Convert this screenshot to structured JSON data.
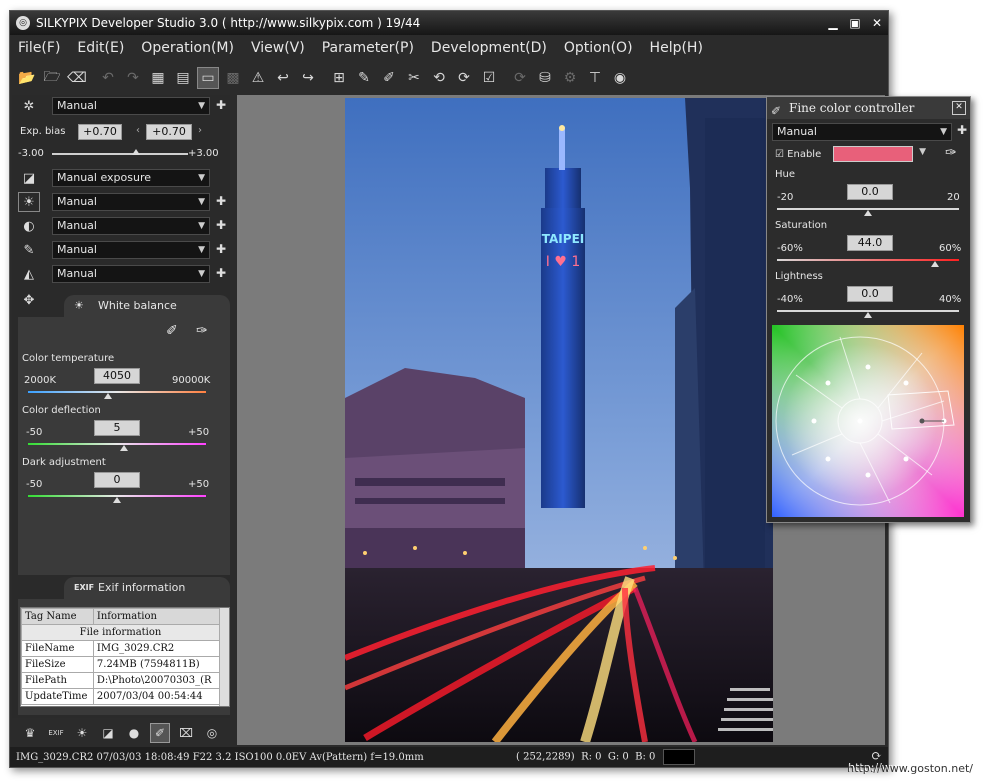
{
  "window": {
    "title": "SILKYPIX Developer Studio 3.0 ( http://www.silkypix.com )   19/44"
  },
  "menu": [
    "File(F)",
    "Edit(E)",
    "Operation(M)",
    "View(V)",
    "Parameter(P)",
    "Development(D)",
    "Option(O)",
    "Help(H)"
  ],
  "toolbar_icons": [
    "open-folder",
    "open-folder-2",
    "eraser",
    "undo",
    "redo",
    "grid-view",
    "filmstrip-view",
    "single-view",
    "compare-view",
    "warning",
    "back",
    "forward",
    "crop-grid",
    "pipette-1",
    "pipette-2",
    "spot",
    "rotate-left",
    "rotate-right",
    "checkmark",
    "refresh",
    "develop",
    "batch",
    "tone",
    "fine-color"
  ],
  "left": {
    "rows": [
      {
        "icon": "gear-icon",
        "value": "Manual"
      },
      {
        "icon": "exposure-icon",
        "value": "Manual exposure"
      },
      {
        "icon": "sun-icon",
        "value": "Manual"
      },
      {
        "icon": "contrast-icon",
        "value": "Manual"
      },
      {
        "icon": "sharpness-icon",
        "value": "Manual"
      },
      {
        "icon": "noise-icon",
        "value": "Manual"
      }
    ],
    "exp_bias": {
      "label": "Exp. bias",
      "value1": "+0.70",
      "value2": "+0.70",
      "min": "-3.00",
      "max": "+3.00",
      "level": 0.617
    },
    "wb": {
      "title": "White balance",
      "temp": {
        "label": "Color temperature",
        "value": "4050",
        "min": "2000K",
        "max": "90000K",
        "level": 0.45
      },
      "deflection": {
        "label": "Color deflection",
        "value": "5",
        "min": "-50",
        "max": "+50",
        "level": 0.54
      },
      "dark": {
        "label": "Dark adjustment",
        "value": "0",
        "min": "-50",
        "max": "+50",
        "level": 0.5
      }
    },
    "exif": {
      "title": "Exif information",
      "head": [
        "Tag Name",
        "Information"
      ],
      "group": "File information",
      "rows": [
        [
          "FileName",
          "IMG_3029.CR2"
        ],
        [
          "FileSize",
          "7.24MB (7594811B)"
        ],
        [
          "FilePath",
          "D:\\Photo\\20070303_(R"
        ],
        [
          "UpdateTime",
          "2007/03/04 00:54:44"
        ]
      ]
    }
  },
  "status": {
    "left": "IMG_3029.CR2 07/03/03 18:08:49 F22  3.2 ISO100  0.0EV Av(Pattern) f=19.0mm",
    "coords": "( 252,2289)",
    "r": "R:   0",
    "g": "G:   0",
    "b": "B:   0"
  },
  "fcc": {
    "title": "Fine color controller",
    "preset": "Manual",
    "enable_label": "Enable",
    "swatch": "#e8607a",
    "hue": {
      "label": "Hue",
      "value": "0.0",
      "min": "-20",
      "max": "20",
      "level": 0.5
    },
    "saturation": {
      "label": "Saturation",
      "value": "44.0",
      "min": "-60%",
      "max": "60%",
      "level": 0.867
    },
    "lightness": {
      "label": "Lightness",
      "value": "0.0",
      "min": "-40%",
      "max": "40%",
      "level": 0.5
    }
  },
  "photo_sign": "TAIPEI",
  "watermark": "http://www.goston.net/"
}
